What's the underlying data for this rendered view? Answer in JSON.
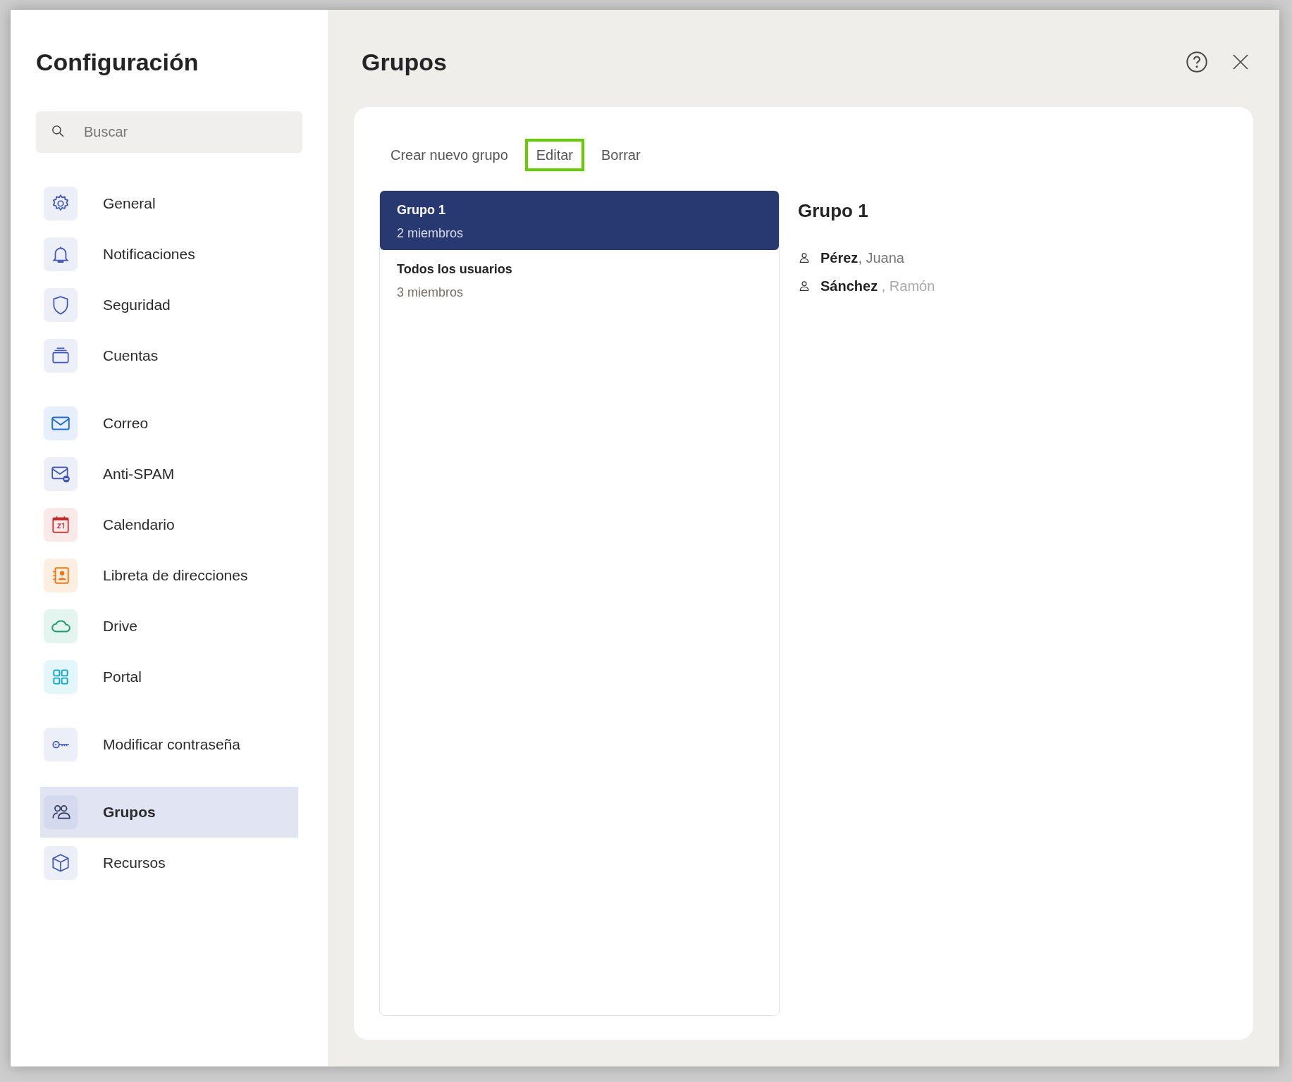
{
  "sidebar": {
    "title": "Configuración",
    "search": {
      "placeholder": "Buscar"
    },
    "sections": [
      [
        {
          "label": "General",
          "selected": false
        },
        {
          "label": "Notificaciones",
          "selected": false
        },
        {
          "label": "Seguridad",
          "selected": false
        },
        {
          "label": "Cuentas",
          "selected": false
        }
      ],
      [
        {
          "label": "Correo",
          "selected": false
        },
        {
          "label": "Anti-SPAM",
          "selected": false
        },
        {
          "label": "Calendario",
          "selected": false
        },
        {
          "label": "Libreta de direcciones",
          "selected": false
        },
        {
          "label": "Drive",
          "selected": false
        },
        {
          "label": "Portal",
          "selected": false
        }
      ],
      [
        {
          "label": "Modificar contraseña",
          "selected": false
        }
      ],
      [
        {
          "label": "Grupos",
          "selected": true
        },
        {
          "label": "Recursos",
          "selected": false
        }
      ]
    ]
  },
  "main": {
    "title": "Grupos",
    "toolbar": [
      {
        "label": "Crear nuevo grupo",
        "highlighted": false
      },
      {
        "label": "Editar",
        "highlighted": true
      },
      {
        "label": "Borrar",
        "highlighted": false
      }
    ],
    "groups": [
      {
        "name": "Grupo 1",
        "members": "2 miembros",
        "selected": true
      },
      {
        "name": "Todos los usuarios",
        "members": "3 miembros",
        "selected": false
      }
    ],
    "detail": {
      "title": "Grupo 1",
      "members": [
        {
          "last": "Pérez",
          "first": ", Juana",
          "dimmed": false
        },
        {
          "last": "Sánchez",
          "first": " , Ramón",
          "dimmed": true
        }
      ]
    }
  }
}
